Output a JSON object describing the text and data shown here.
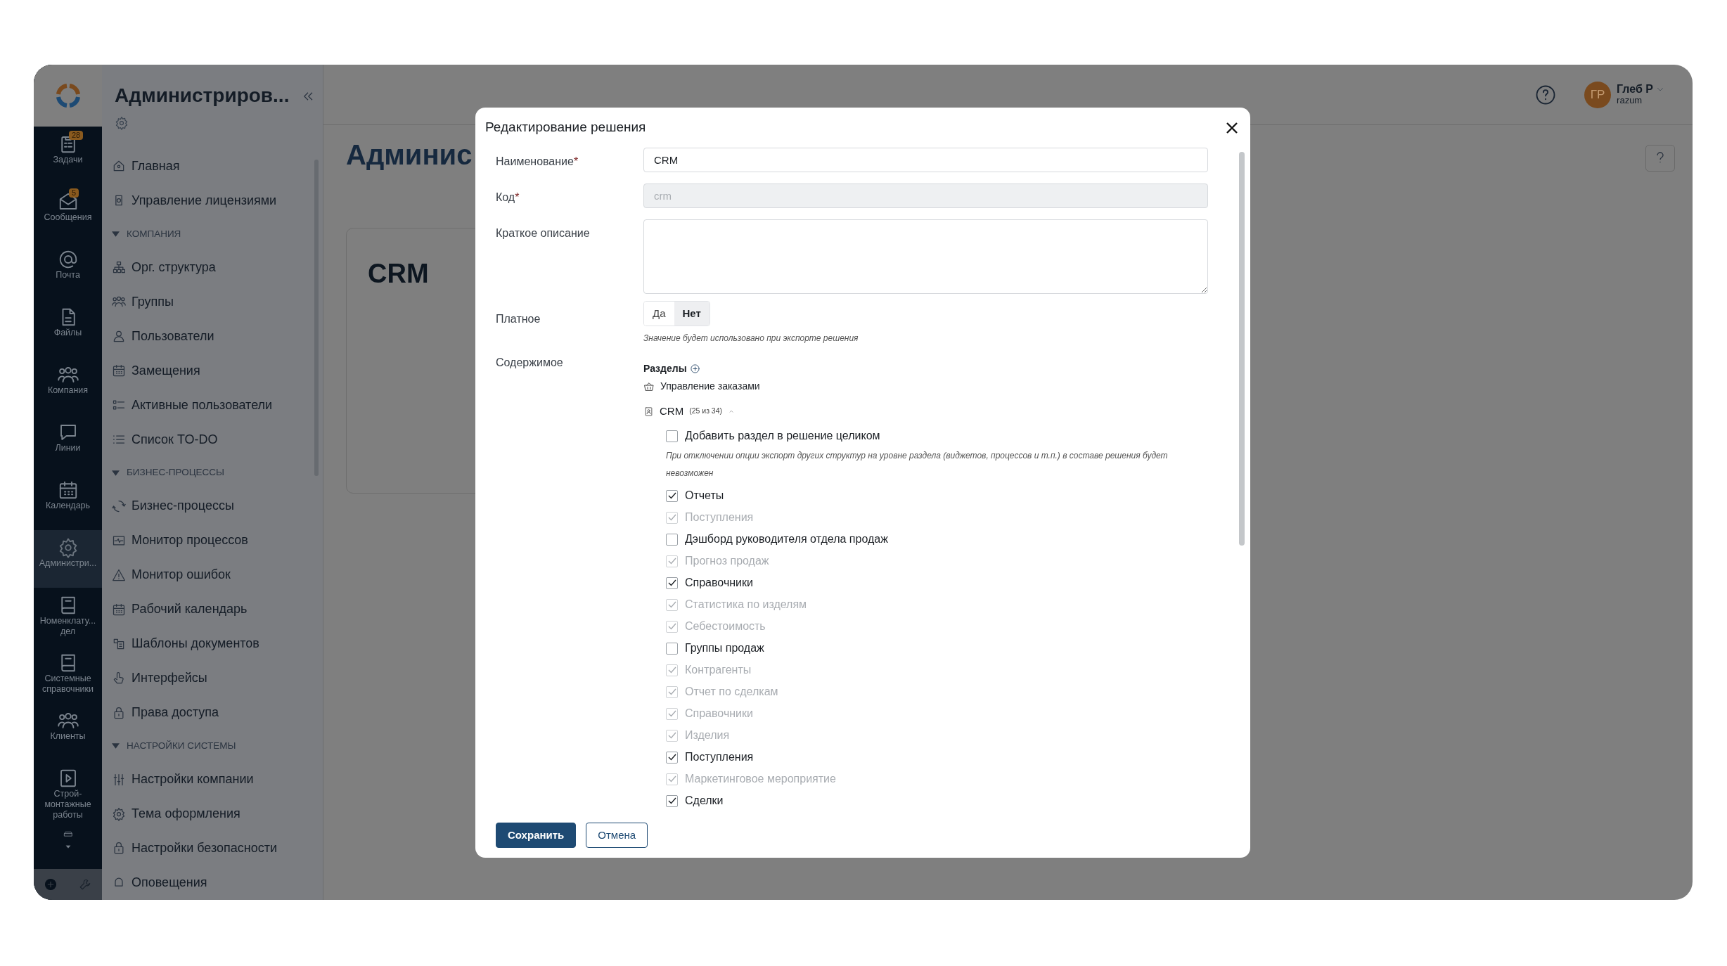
{
  "rail": {
    "items": [
      {
        "label": "Задачи",
        "badge": "28",
        "selected": false
      },
      {
        "label": "Сообщения",
        "badge": "5",
        "selected": false
      },
      {
        "label": "Почта",
        "selected": false
      },
      {
        "label": "Файлы",
        "selected": false
      },
      {
        "label": "Компания",
        "selected": false
      },
      {
        "label": "Линии",
        "selected": false
      },
      {
        "label": "Календарь",
        "selected": false
      },
      {
        "label": "Администри...",
        "selected": true
      },
      {
        "label": "Номенклату...\nдел",
        "selected": false
      },
      {
        "label": "Системные\nсправочники",
        "selected": false
      },
      {
        "label": "Клиенты",
        "selected": false
      },
      {
        "label": "Строй-\nмонтажные\nработы",
        "selected": false
      }
    ]
  },
  "sidebar": {
    "title": "Администриров...",
    "items": [
      {
        "kind": "item",
        "label": "Главная"
      },
      {
        "kind": "item",
        "label": "Управление лицензиями"
      },
      {
        "kind": "section",
        "label": "КОМПАНИЯ",
        "expanded": true
      },
      {
        "kind": "item",
        "label": "Орг. структура"
      },
      {
        "kind": "item",
        "label": "Группы"
      },
      {
        "kind": "item",
        "label": "Пользователи"
      },
      {
        "kind": "item",
        "label": "Замещения"
      },
      {
        "kind": "item",
        "label": "Активные пользователи"
      },
      {
        "kind": "item",
        "label": "Список TO-DO"
      },
      {
        "kind": "section",
        "label": "БИЗНЕС-ПРОЦЕССЫ",
        "expanded": true
      },
      {
        "kind": "item",
        "label": "Бизнес-процессы"
      },
      {
        "kind": "item",
        "label": "Монитор процессов"
      },
      {
        "kind": "item",
        "label": "Монитор ошибок"
      },
      {
        "kind": "item",
        "label": "Рабочий календарь"
      },
      {
        "kind": "item",
        "label": "Шаблоны документов"
      },
      {
        "kind": "item",
        "label": "Интерфейсы"
      },
      {
        "kind": "item",
        "label": "Права доступа"
      },
      {
        "kind": "section",
        "label": "НАСТРОЙКИ СИСТЕМЫ",
        "expanded": true
      },
      {
        "kind": "item",
        "label": "Настройки компании"
      },
      {
        "kind": "item",
        "label": "Тема оформления"
      },
      {
        "kind": "item",
        "label": "Настройки безопасности"
      },
      {
        "kind": "item",
        "label": "Оповещения"
      }
    ]
  },
  "header": {
    "user": {
      "initials": "ГР",
      "name": "Глеб Р",
      "login": "razum"
    }
  },
  "page": {
    "title": "Админис",
    "card_title": "CRM"
  },
  "modal": {
    "title": "Редактирование решения",
    "fields": [
      {
        "kind": "text",
        "label": "Наименование",
        "required_mark": "*",
        "value": "CRM",
        "disabled": false
      },
      {
        "kind": "text",
        "label": "Код",
        "required_mark": "*",
        "value": "crm",
        "disabled": true
      },
      {
        "kind": "textarea",
        "label": "Краткое описание",
        "disabled": false
      }
    ],
    "paid": {
      "label": "Платное",
      "options": [
        {
          "label": "Да",
          "selected": false
        },
        {
          "label": "Нет",
          "selected": true
        }
      ],
      "hint": "Значение будет использовано при экспорте решения"
    },
    "content": {
      "label": "Содержимое",
      "sections_label": "Разделы",
      "groups": [
        {
          "label": "Управление заказами"
        }
      ],
      "module": {
        "label": "CRM",
        "count": "(25 из 34)",
        "expanded": true
      },
      "whole": {
        "label": "Добавить раздел в решение целиком",
        "checked": false
      },
      "note": "При отключении опции экспорт других структур на уровне раздела (виджетов, процессов и т.п.) в составе решения будет невозможен",
      "items": [
        {
          "label": "Отчеты",
          "checked": true,
          "disabled": false
        },
        {
          "label": "Поступления",
          "checked": true,
          "disabled": true
        },
        {
          "label": "Дэшборд руководителя отдела продаж",
          "checked": false,
          "disabled": false
        },
        {
          "label": "Прогноз продаж",
          "checked": true,
          "disabled": true
        },
        {
          "label": "Справочники",
          "checked": true,
          "disabled": false
        },
        {
          "label": "Статистика по изделям",
          "checked": true,
          "disabled": true
        },
        {
          "label": "Себестоимость",
          "checked": true,
          "disabled": true
        },
        {
          "label": "Группы продаж",
          "checked": false,
          "disabled": false
        },
        {
          "label": "Контрагенты",
          "checked": true,
          "disabled": true
        },
        {
          "label": "Отчет по сделкам",
          "checked": true,
          "disabled": true
        },
        {
          "label": "Справочники",
          "checked": true,
          "disabled": true
        },
        {
          "label": "Изделия",
          "checked": true,
          "disabled": true
        },
        {
          "label": "Поступления",
          "checked": true,
          "disabled": false
        },
        {
          "label": "Маркетинговое мероприятие",
          "checked": true,
          "disabled": true
        },
        {
          "label": "Сделки",
          "checked": true,
          "disabled": false
        }
      ]
    },
    "buttons": [
      {
        "kind": "primary",
        "label": "Сохранить"
      },
      {
        "kind": "secondary",
        "label": "Отмена"
      }
    ]
  }
}
